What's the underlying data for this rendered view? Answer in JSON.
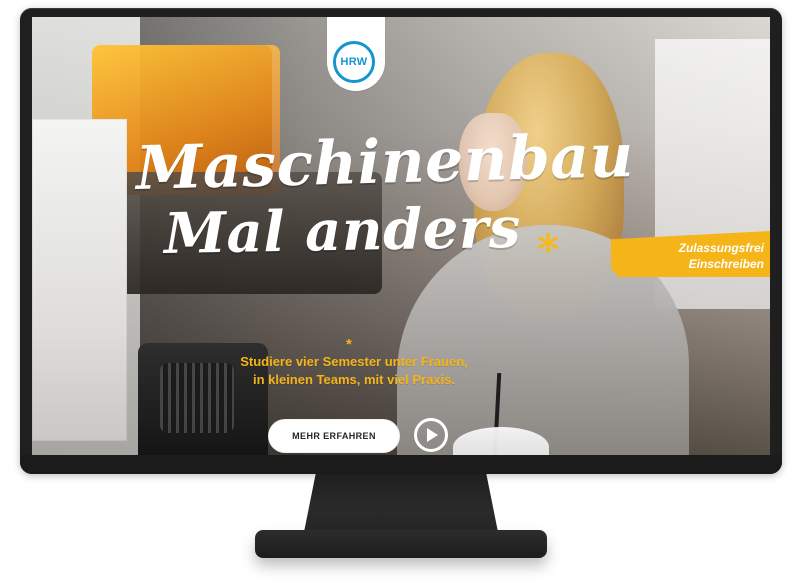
{
  "logo": {
    "text": "HRW",
    "color": "#1694d1",
    "icon": "hrw-logo-icon"
  },
  "hero": {
    "headline_line1": "Maschinenbau",
    "headline_line2": "Mal anders",
    "headline_asterisk": "*",
    "asterisk_small": "*",
    "subtext_line1": "Studiere vier Semester unter Frauen,",
    "subtext_line2": "in kleinen Teams, mit viel Praxis.",
    "cta_label": "MEHR ERFAHREN",
    "play_icon": "play-icon"
  },
  "badge": {
    "line1": "Zulassungsfrei",
    "line2": "Einschreiben",
    "color": "#f5b418"
  },
  "colors": {
    "accent": "#f5b418",
    "headline": "#ffffff",
    "monitor": "#1f1f1f"
  }
}
